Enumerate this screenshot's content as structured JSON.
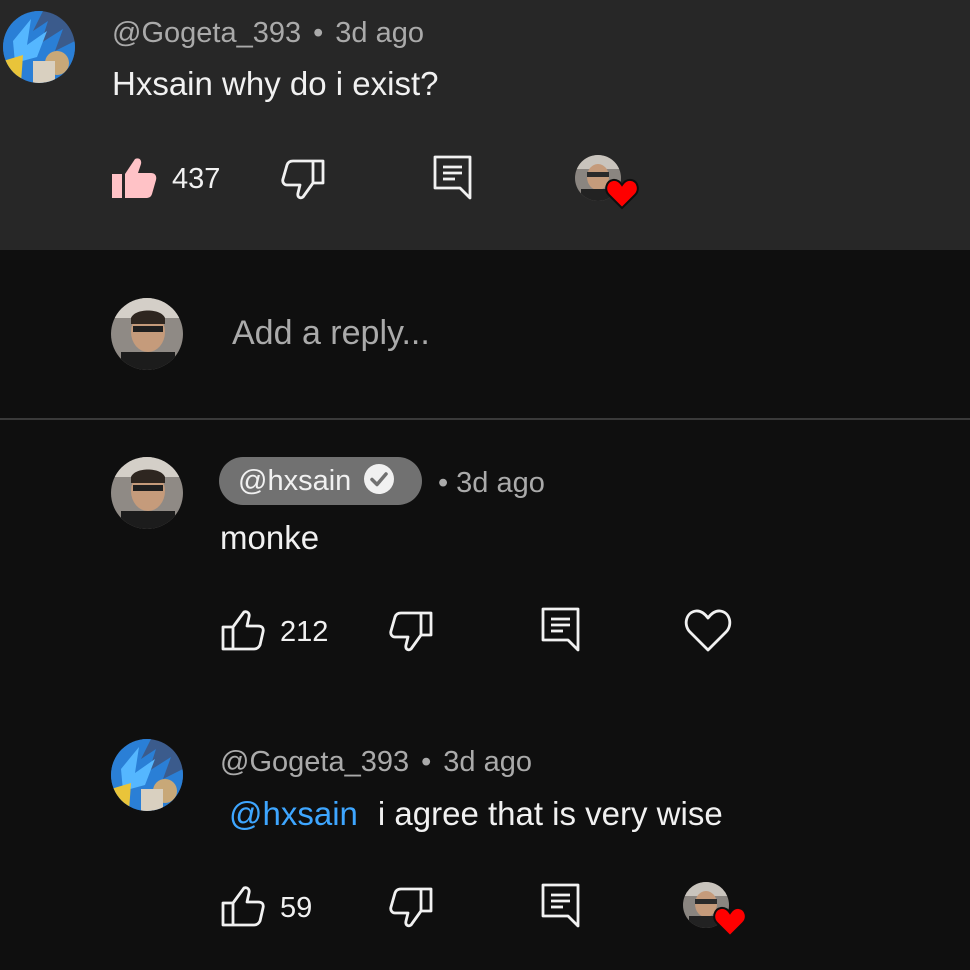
{
  "comment": {
    "author": "@Gogeta_393",
    "separator": "•",
    "time": "3d ago",
    "text": "Hxsain why do i exist?",
    "likes": "437",
    "liked": true,
    "hearted_by_creator": true
  },
  "reply_box": {
    "placeholder": "Add a reply..."
  },
  "replies": [
    {
      "author": "@hxsain",
      "verified": true,
      "separator": "•",
      "time": "3d ago",
      "text": "monke",
      "likes": "212"
    },
    {
      "author": "@Gogeta_393",
      "separator": "•",
      "time": "3d ago",
      "mention": "@hxsain",
      "text": "i agree that is very wise",
      "likes": "59",
      "hearted_by_creator": true
    }
  ],
  "colors": {
    "background": "#0f0f0f",
    "highlight": "#272727",
    "liked_thumb": "#ffc2c6",
    "mention": "#3ea6ff",
    "heart": "#ff0000",
    "chip": "#717171"
  },
  "icons": [
    "thumb-up-icon",
    "thumb-down-icon",
    "reply-icon",
    "heart-icon",
    "verified-check-icon",
    "creator-heart-icon"
  ]
}
